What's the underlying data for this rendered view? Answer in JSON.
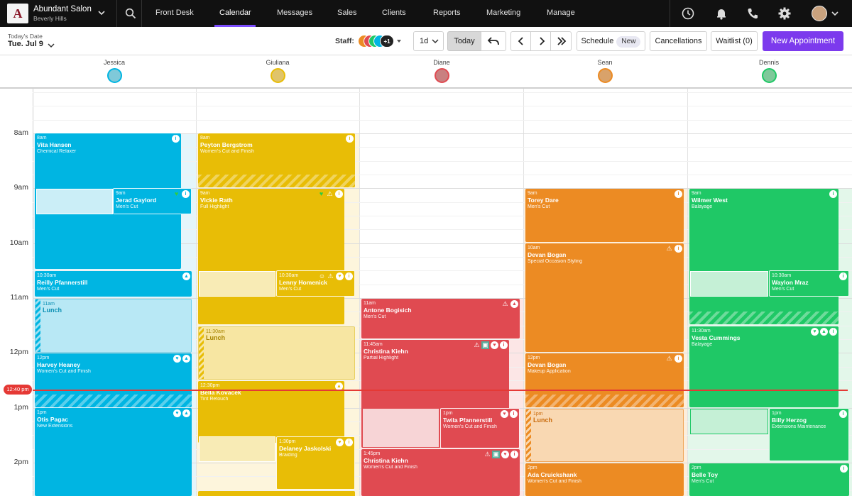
{
  "salon": {
    "name": "Abundant Salon",
    "location": "Beverly Hills",
    "logo": "A"
  },
  "nav": {
    "items": [
      "Front Desk",
      "Calendar",
      "Messages",
      "Sales",
      "Clients",
      "Reports",
      "Marketing",
      "Manage"
    ],
    "active": "Calendar"
  },
  "toolbar": {
    "date_label": "Today's Date",
    "date_value": "Tue. Jul 9",
    "staff_label": "Staff:",
    "staff_more": "+1",
    "view": "1d",
    "today": "Today",
    "schedule": "Schedule",
    "schedule_badge": "New",
    "cancellations": "Cancellations",
    "waitlist": "Waitlist (0)",
    "new_appointment": "New Appointment"
  },
  "staff": [
    {
      "name": "Jessica",
      "color": "#00b5e2"
    },
    {
      "name": "Giuliana",
      "color": "#e8bd06"
    },
    {
      "name": "Diane",
      "color": "#e04a51"
    },
    {
      "name": "Sean",
      "color": "#ec8b23"
    },
    {
      "name": "Dennis",
      "color": "#1fc866"
    }
  ],
  "hours": [
    "8am",
    "9am",
    "10am",
    "11am",
    "12pm",
    "1pm",
    "2pm"
  ],
  "current_time": "12:40 pm",
  "appointments": {
    "a1": {
      "time": "8am",
      "client": "Vita Hansen",
      "service": "Chemical Relaxer"
    },
    "a2": {
      "time": "9am",
      "client": "Jerad Gaylord",
      "service": "Men's Cut"
    },
    "a3": {
      "time": "10:30am",
      "client": "Reilly Pfannerstill",
      "service": "Men's Cut"
    },
    "a4": {
      "time": "11am",
      "client": "Lunch",
      "service": ""
    },
    "a5": {
      "time": "12pm",
      "client": "Harvey Heaney",
      "service": "Women's Cut and Finish"
    },
    "a6": {
      "time": "1pm",
      "client": "Otis Pagac",
      "service": "New Extensions"
    },
    "b1": {
      "time": "8am",
      "client": "Peyton Bergstrom",
      "service": "Women's Cut and Finish"
    },
    "b2": {
      "time": "9am",
      "client": "Vickie Rath",
      "service": "Full Highlight"
    },
    "b3": {
      "time": "10:30am",
      "client": "Lenny Homenick",
      "service": "Men's Cut"
    },
    "b4": {
      "time": "11:30am",
      "client": "Lunch",
      "service": ""
    },
    "b5": {
      "time": "12:30pm",
      "client": "Bella Kovacek",
      "service": "Tint Retouch"
    },
    "b6": {
      "time": "1:30pm",
      "client": "Delaney Jaskolski",
      "service": "Braiding"
    },
    "c1": {
      "time": "11am",
      "client": "Antone Bogisich",
      "service": "Men's Cut"
    },
    "c2": {
      "time": "11:45am",
      "client": "Christina Kiehn",
      "service": "Partial Highlight"
    },
    "c3": {
      "time": "1pm",
      "client": "Twila Pfannerstill",
      "service": "Women's Cut and Finish"
    },
    "c4": {
      "time": "1:45pm",
      "client": "Christina Kiehn",
      "service": "Women's Cut and Finish"
    },
    "d1": {
      "time": "9am",
      "client": "Torey Dare",
      "service": "Men's Cut"
    },
    "d2": {
      "time": "10am",
      "client": "Devan Bogan",
      "service": "Special Occasion Styling"
    },
    "d3": {
      "time": "12pm",
      "client": "Devan Bogan",
      "service": "Makeup Application"
    },
    "d4": {
      "time": "1pm",
      "client": "Lunch",
      "service": ""
    },
    "d5": {
      "time": "2pm",
      "client": "Ada Cruickshank",
      "service": "Women's Cut and Finish"
    },
    "e1": {
      "time": "9am",
      "client": "Wilmer West",
      "service": "Balayage"
    },
    "e2": {
      "time": "10:30am",
      "client": "Waylon Mraz",
      "service": "Men's Cut"
    },
    "e3": {
      "time": "11:30am",
      "client": "Vesta Cummings",
      "service": "Balayage"
    },
    "e4": {
      "time": "1pm",
      "client": "Billy Herzog",
      "service": "Extensions Maintenance"
    },
    "e5": {
      "time": "2pm",
      "client": "Belle Toy",
      "service": "Men's Cut"
    }
  }
}
